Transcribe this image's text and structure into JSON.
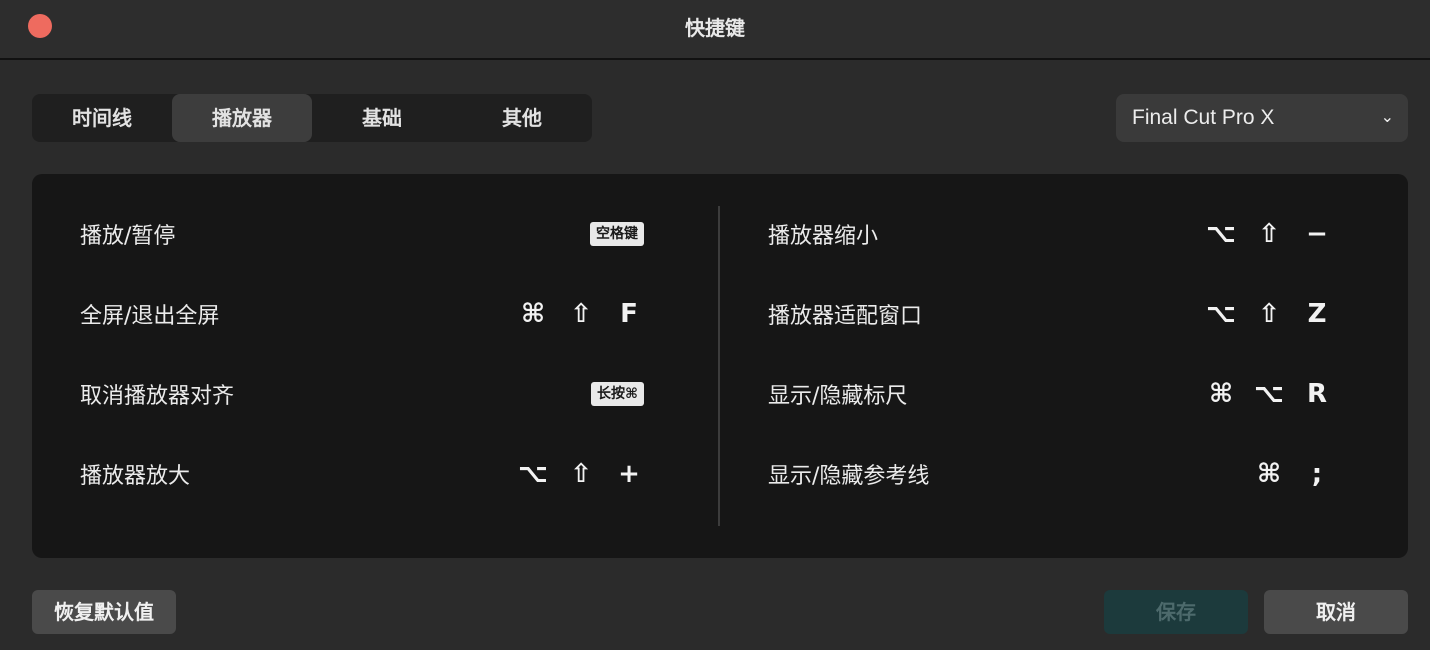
{
  "window": {
    "title": "快捷键"
  },
  "tabs": [
    {
      "label": "时间线",
      "active": false
    },
    {
      "label": "播放器",
      "active": true
    },
    {
      "label": "基础",
      "active": false
    },
    {
      "label": "其他",
      "active": false
    }
  ],
  "preset": {
    "selected": "Final Cut Pro X",
    "icon": "chevron-down-icon"
  },
  "shortcuts": {
    "left": [
      {
        "label": "播放/暂停",
        "badge": "空格键",
        "keys": []
      },
      {
        "label": "全屏/退出全屏",
        "badge": null,
        "keys": [
          "⌘",
          "⇧",
          "F"
        ]
      },
      {
        "label": "取消播放器对齐",
        "badge": "长按⌘",
        "keys": []
      },
      {
        "label": "播放器放大",
        "badge": null,
        "keys": [
          "⌥",
          "⇧",
          "+"
        ]
      }
    ],
    "right": [
      {
        "label": "播放器缩小",
        "badge": null,
        "keys": [
          "⌥",
          "⇧",
          "−"
        ]
      },
      {
        "label": "播放器适配窗口",
        "badge": null,
        "keys": [
          "⌥",
          "⇧",
          "Z"
        ]
      },
      {
        "label": "显示/隐藏标尺",
        "badge": null,
        "keys": [
          "⌘",
          "⌥",
          "R"
        ]
      },
      {
        "label": "显示/隐藏参考线",
        "badge": null,
        "keys": [
          "⌘",
          ";"
        ]
      }
    ]
  },
  "buttons": {
    "reset": "恢复默认值",
    "save": "保存",
    "cancel": "取消"
  },
  "colors": {
    "close": "#ee6b5f",
    "save_bg": "#1c3a3c",
    "save_text": "#4d6a6c"
  }
}
